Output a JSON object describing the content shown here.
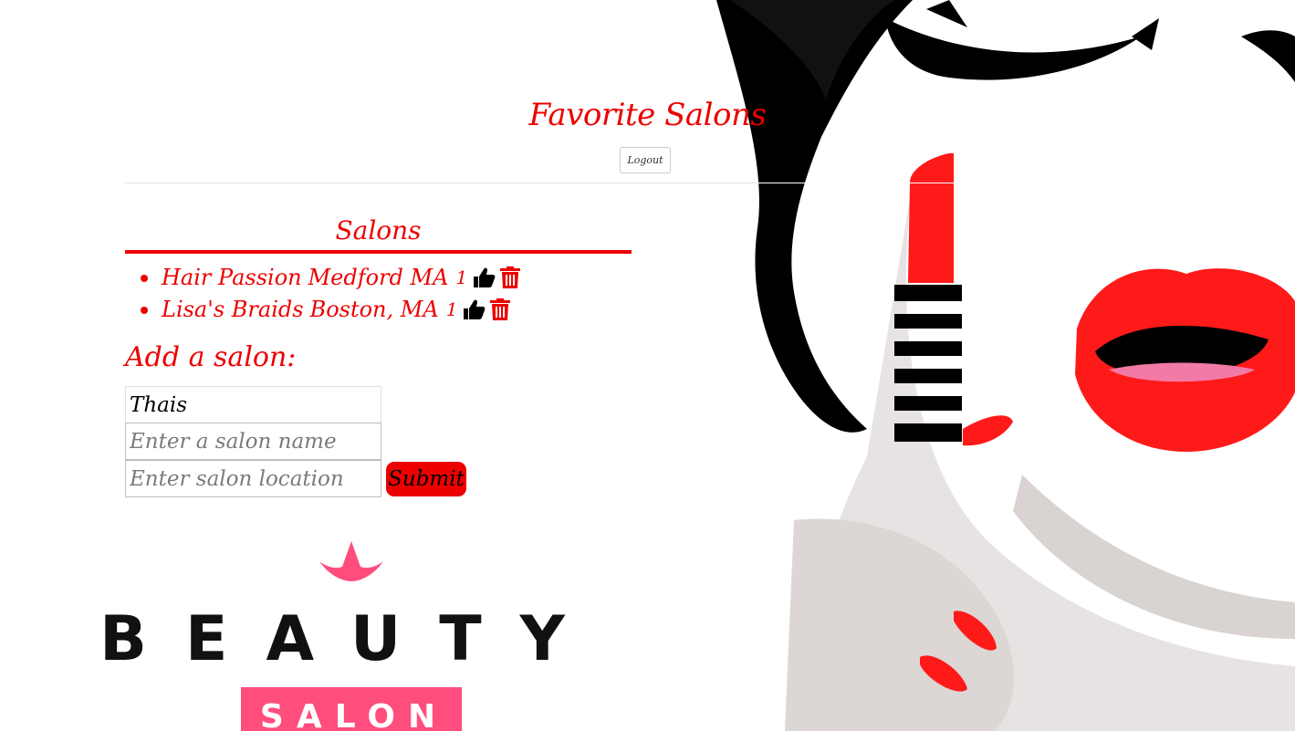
{
  "header": {
    "title": "Favorite Salons",
    "logout_label": "Logout"
  },
  "salons_section": {
    "title": "Salons",
    "items": [
      {
        "name": "Hair Passion",
        "location": "Medford MA",
        "likes": "1"
      },
      {
        "name": "Lisa's Braids",
        "location": "Boston, MA",
        "likes": "1"
      }
    ]
  },
  "add_form": {
    "title": "Add a salon:",
    "name_value": "Thais",
    "name_placeholder": "Enter a salon name",
    "location_placeholder": "Enter salon location",
    "submit_label": "Submit"
  },
  "logo": {
    "word1": "BEAUTY",
    "word2": "SALON"
  },
  "icons": {
    "like": "thumbs-up-icon",
    "delete": "trash-icon"
  },
  "colors": {
    "accent": "#ec0000",
    "lips": "#ff1a1a",
    "logo_pink": "#ff4d7d"
  }
}
